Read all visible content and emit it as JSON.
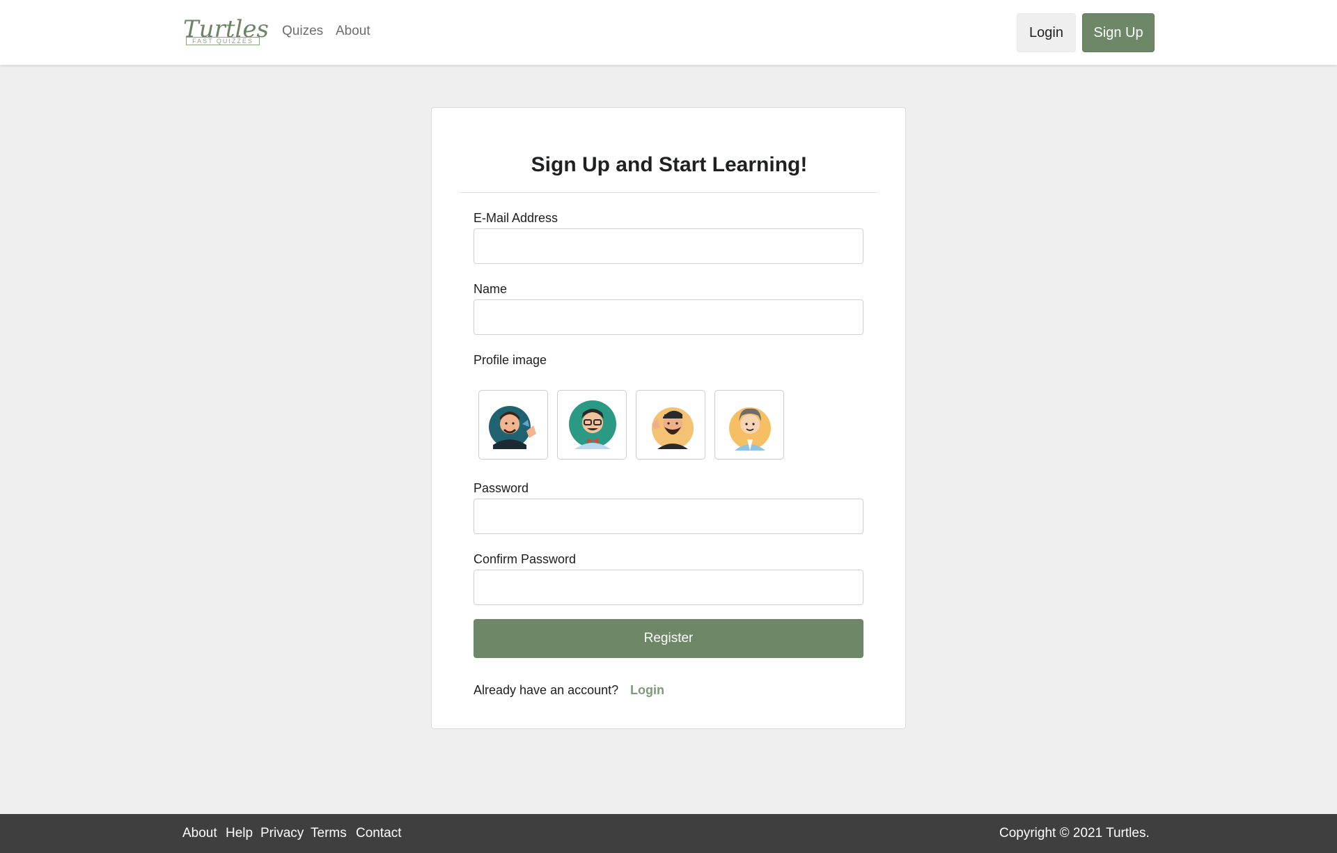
{
  "navbar": {
    "brand_word": "Turtles",
    "brand_sub": "FAST QUIZZES",
    "links": [
      "Quizes",
      "About"
    ],
    "login_label": "Login",
    "signup_label": "Sign Up"
  },
  "form": {
    "title": "Sign Up and Start Learning!",
    "email_label": "E-Mail Address",
    "email_value": "",
    "name_label": "Name",
    "name_value": "",
    "profile_label": "Profile image",
    "avatars": [
      "avatar-waving-man",
      "avatar-bowtie-man",
      "avatar-bearded-man",
      "avatar-grey-haired-man"
    ],
    "password_label": "Password",
    "password_value": "",
    "confirm_label": "Confirm Password",
    "confirm_value": "",
    "register_label": "Register",
    "already_text": "Already have an account?",
    "login_link": "Login"
  },
  "footer": {
    "links": [
      "About",
      "Help",
      "Privacy",
      "Terms",
      "Contact"
    ],
    "copyright": "Copyright © 2021 Turtles."
  },
  "colors": {
    "accent": "#6d8767",
    "footer_bg": "#3f3f3f",
    "page_bg": "#efefef"
  }
}
